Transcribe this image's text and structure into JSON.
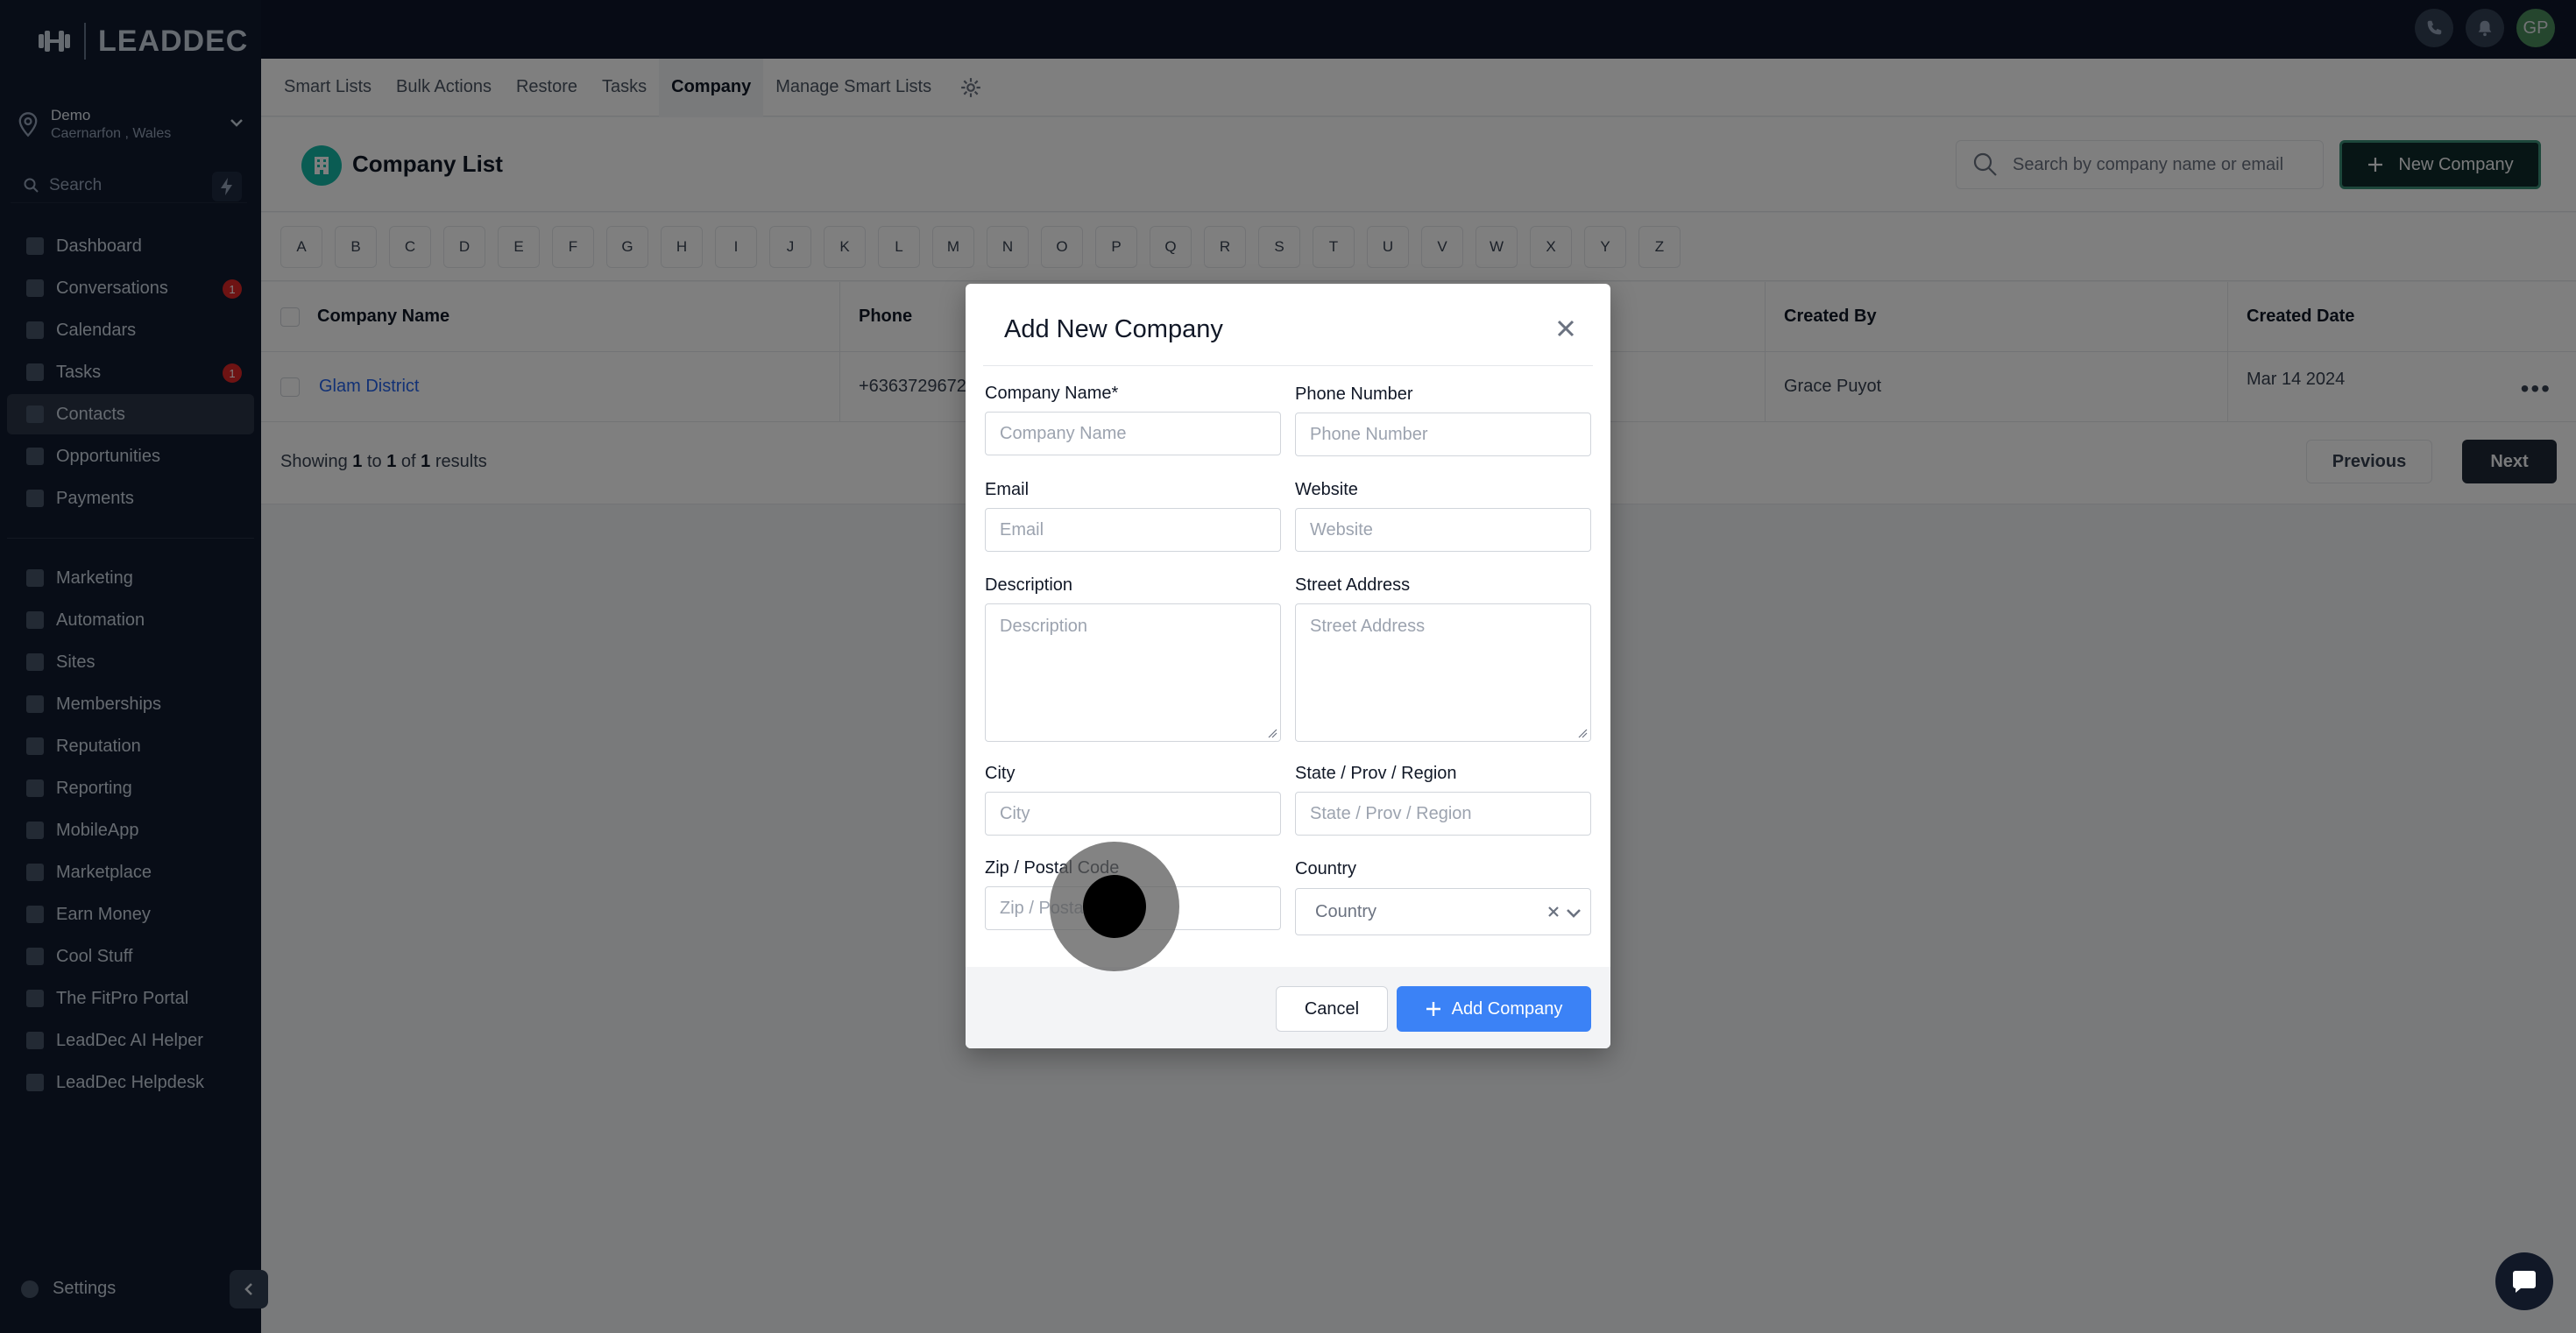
{
  "app": {
    "logo_text": "LEADDEC",
    "avatar_initials": "GP",
    "accent": "#3b82f6",
    "brand_teal": "#14b8a6"
  },
  "location": {
    "name": "Demo",
    "sub": "Caernarfon , Wales"
  },
  "sidebar_search": {
    "placeholder": "Search"
  },
  "sidebar": {
    "items_top": [
      {
        "label": "Dashboard",
        "icon": "dashboard-icon"
      },
      {
        "label": "Conversations",
        "icon": "chat-icon",
        "badge": "1"
      },
      {
        "label": "Calendars",
        "icon": "calendar-icon"
      },
      {
        "label": "Tasks",
        "icon": "tasks-icon",
        "badge": "1"
      },
      {
        "label": "Contacts",
        "icon": "person-icon",
        "active": true
      },
      {
        "label": "Opportunities",
        "icon": "filter-icon"
      },
      {
        "label": "Payments",
        "icon": "card-icon"
      }
    ],
    "items_bottom": [
      {
        "label": "Marketing",
        "icon": "megaphone-icon"
      },
      {
        "label": "Automation",
        "icon": "automation-icon"
      },
      {
        "label": "Sites",
        "icon": "sites-icon"
      },
      {
        "label": "Memberships",
        "icon": "members-icon"
      },
      {
        "label": "Reputation",
        "icon": "star-icon"
      },
      {
        "label": "Reporting",
        "icon": "chart-icon"
      },
      {
        "label": "MobileApp",
        "icon": "phone-icon"
      },
      {
        "label": "Marketplace",
        "icon": "cart-icon"
      },
      {
        "label": "Earn Money",
        "icon": "money-icon"
      },
      {
        "label": "Cool Stuff",
        "icon": "flame-icon"
      },
      {
        "label": "The FitPro Portal",
        "icon": "dumbbell-icon"
      },
      {
        "label": "LeadDec AI Helper",
        "icon": "robot-icon"
      },
      {
        "label": "LeadDec Helpdesk",
        "icon": "info-icon"
      }
    ],
    "settings_label": "Settings"
  },
  "tabs": [
    {
      "label": "Smart Lists"
    },
    {
      "label": "Bulk Actions"
    },
    {
      "label": "Restore"
    },
    {
      "label": "Tasks"
    },
    {
      "label": "Company",
      "active": true
    },
    {
      "label": "Manage Smart Lists"
    }
  ],
  "header": {
    "title": "Company List",
    "search_placeholder": "Search by company name or email",
    "new_button": "New Company"
  },
  "alphabet": [
    "A",
    "B",
    "C",
    "D",
    "E",
    "F",
    "G",
    "H",
    "I",
    "J",
    "K",
    "L",
    "M",
    "N",
    "O",
    "P",
    "Q",
    "R",
    "S",
    "T",
    "U",
    "V",
    "W",
    "X",
    "Y",
    "Z"
  ],
  "table": {
    "columns": [
      "Company Name",
      "Phone",
      "Created By",
      "Created Date"
    ],
    "rows": [
      {
        "company": "Glam District",
        "phone": "+6363729672",
        "created_by": "Grace Puyot",
        "created_date": "Mar 14 2024"
      }
    ]
  },
  "pagination": {
    "showing_prefix": "Showing",
    "from": "1",
    "to_word": "to",
    "to": "1",
    "of_word": "of",
    "total": "1",
    "suffix": "results",
    "previous": "Previous",
    "next": "Next"
  },
  "modal": {
    "title": "Add New Company",
    "fields": {
      "company_name": {
        "label": "Company Name*",
        "placeholder": "Company Name"
      },
      "phone": {
        "label": "Phone Number",
        "placeholder": "Phone Number"
      },
      "email": {
        "label": "Email",
        "placeholder": "Email"
      },
      "website": {
        "label": "Website",
        "placeholder": "Website"
      },
      "description": {
        "label": "Description",
        "placeholder": "Description"
      },
      "street": {
        "label": "Street Address",
        "placeholder": "Street Address"
      },
      "city": {
        "label": "City",
        "placeholder": "City"
      },
      "state": {
        "label": "State / Prov / Region",
        "placeholder": "State / Prov / Region"
      },
      "zip": {
        "label": "Zip / Postal Code",
        "placeholder": "Zip / Postal Code"
      },
      "country": {
        "label": "Country",
        "placeholder": "Country"
      }
    },
    "cancel": "Cancel",
    "submit": "Add Company"
  }
}
